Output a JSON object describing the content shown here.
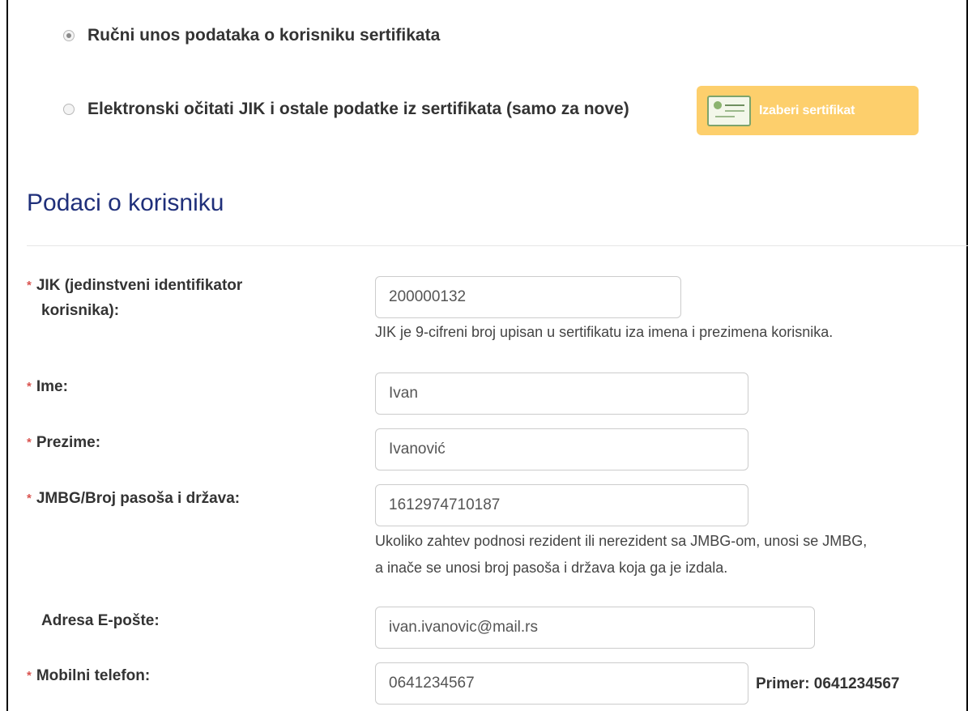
{
  "options": {
    "manual_label": "Ručni unos podataka o korisniku sertifikata",
    "electronic_label": "Elektronski očitati JIK i ostale podatke iz sertifikata (samo za nove)",
    "select_cert_button": "Izaberi sertifikat"
  },
  "section": {
    "title": "Podaci o korisniku"
  },
  "fields": {
    "jik": {
      "label_line1": "JIK (jedinstveni identifikator",
      "label_line2": "korisnika):",
      "value": "200000132",
      "help": "JIK je 9-cifreni broj upisan u sertifikatu iza imena i prezimena korisnika."
    },
    "ime": {
      "label": "Ime:",
      "value": "Ivan"
    },
    "prezime": {
      "label": "Prezime:",
      "value": "Ivanović"
    },
    "jmbg": {
      "label": "JMBG/Broj pasoša i država:",
      "value": "1612974710187",
      "help_line1": "Ukoliko zahtev podnosi rezident ili nerezident sa JMBG-om, unosi se JMBG,",
      "help_line2": "a inače se unosi broj pasoša i država koja ga je izdala."
    },
    "email": {
      "label": "Adresa E-pošte:",
      "value": "ivan.ivanovic@mail.rs"
    },
    "mobile": {
      "label": "Mobilni telefon:",
      "value": "0641234567",
      "example": "Primer: 0641234567"
    }
  },
  "required_marker": "*",
  "colors": {
    "accent_button": "#fdcf6c",
    "title": "#1f2f7a",
    "required": "#d9534f"
  },
  "icons": {
    "certificate": "certificate-icon"
  }
}
